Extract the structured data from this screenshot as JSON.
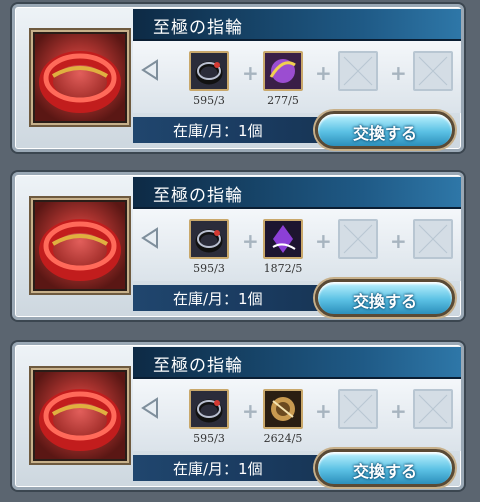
{
  "offers": [
    {
      "title": "至極の指輪",
      "costs": [
        {
          "icon": "dark-ring-icon",
          "qty": "595/3"
        },
        {
          "icon": "purple-orb-icon",
          "qty": "277/5"
        }
      ],
      "stock": "在庫/月：1個",
      "button": "交換する"
    },
    {
      "title": "至極の指輪",
      "costs": [
        {
          "icon": "dark-ring-icon",
          "qty": "595/3"
        },
        {
          "icon": "violet-crystal-icon",
          "qty": "1872/5"
        }
      ],
      "stock": "在庫/月：1個",
      "button": "交換する"
    },
    {
      "title": "至極の指輪",
      "costs": [
        {
          "icon": "dark-ring-icon",
          "qty": "595/3"
        },
        {
          "icon": "golden-orb-icon",
          "qty": "2624/5"
        }
      ],
      "stock": "在庫/月：1個",
      "button": "交換する"
    }
  ],
  "colors": {
    "title_bar": "#1f5a86",
    "button": "#5bc1e4",
    "ring": "#d43a33"
  }
}
